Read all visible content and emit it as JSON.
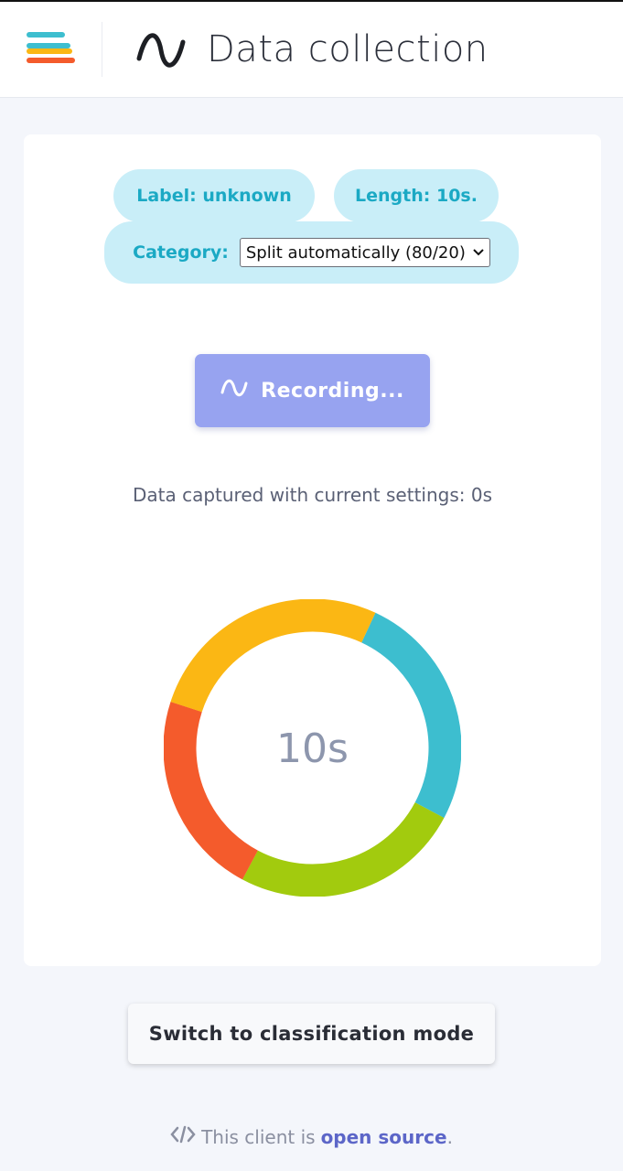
{
  "header": {
    "title": "Data collection",
    "menu_icon": "menu-stack-icon",
    "title_icon": "sine-wave-icon"
  },
  "settings": {
    "label_text": "Label: unknown",
    "length_text": "Length: 10s.",
    "category_label": "Category:",
    "category_selected": "Split automatically (80/20)"
  },
  "record": {
    "button_label": "Recording...",
    "icon": "sine-wave-icon"
  },
  "status": {
    "captured_text": "Data captured with current settings: 0s"
  },
  "timer": {
    "center_text": "10s",
    "segment_colors": [
      "#3dbecf",
      "#a2cb0e",
      "#f45b2c",
      "#fbb714"
    ]
  },
  "actions": {
    "switch_mode_label": "Switch to classification mode"
  },
  "footer": {
    "prefix": "This client is",
    "link_text": "open source",
    "suffix": ".",
    "icon": "code-icon"
  },
  "colors": {
    "accent_cyan": "#1ba9c4",
    "pill_bg": "#c9eef8",
    "record_button": "#97a3f0",
    "link": "#5c66c8"
  }
}
